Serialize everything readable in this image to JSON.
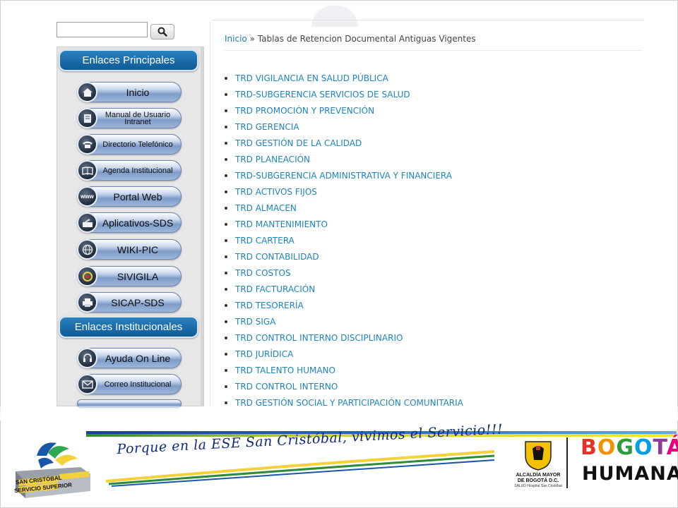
{
  "search": {
    "placeholder": "",
    "button_icon": "magnifier-icon"
  },
  "sidebar": {
    "section_main": "Enlaces Principales",
    "main_links": [
      {
        "label": "Inicio",
        "icon": "home-icon"
      },
      {
        "label": "Manual de Usuario Intranet",
        "icon": "manual-icon"
      },
      {
        "label": "Directorio Telefónico",
        "icon": "phone-icon"
      },
      {
        "label": "Agenda Institucional",
        "icon": "book-icon"
      },
      {
        "label": "Portal Web",
        "icon": "www-icon"
      },
      {
        "label": "Aplicativos-SDS",
        "icon": "apps-icon"
      },
      {
        "label": "WIKI-PIC",
        "icon": "globe-icon"
      },
      {
        "label": "SIVIGILA",
        "icon": "eye-icon"
      },
      {
        "label": "SICAP-SDS",
        "icon": "printer-icon"
      }
    ],
    "section_inst": "Enlaces Institucionales",
    "inst_links": [
      {
        "label": "Ayuda On Line",
        "icon": "headset-icon"
      },
      {
        "label": "Correo Institucional",
        "icon": "mail-icon"
      }
    ]
  },
  "breadcrumb": {
    "home": "Inicio",
    "separator": " » ",
    "current": "Tablas de Retencion Documental Antiguas Vigentes"
  },
  "trd_items": [
    "TRD VIGILANCIA EN SALUD PÚBLICA",
    "TRD-SUBGERENCIA SERVICIOS DE SALUD",
    "TRD PROMOCIÓN Y PREVENCIÓN",
    "TRD GERENCIA",
    "TRD GESTIÓN DE LA CALIDAD",
    "TRD PLANEACIÓN",
    "TRD-SUBGERENCIA ADMINISTRATIVA Y FINANCIERA",
    "TRD ACTIVOS FIJOS",
    "TRD ALMACEN",
    "TRD MANTENIMIENTO",
    "TRD CARTERA",
    "TRD CONTABILIDAD",
    "TRD COSTOS",
    "TRD FACTURACIÓN",
    "TRD TESORERÍA",
    "TRD SIGA",
    "TRD CONTROL INTERNO DISCIPLINARIO",
    "TRD JURÍDICA",
    "TRD TALENTO HUMANO",
    "TRD CONTROL INTERNO",
    "TRD GESTIÓN SOCIAL Y PARTICIPACIÓN  COMUNITARIA"
  ],
  "footer": {
    "slogan": "Porque en la ESE San Cristóbal, vivimos el Servicio!!!",
    "ese_logo_text_1": "SAN CRISTÓBAL",
    "ese_logo_text_2": "SERVICIO SUPERIOR",
    "alcaldia": "ALCALDÍA MAYOR DE BOGOTÁ D.C.",
    "alcaldia_sub": "SALUD Hospital San Cristóbal",
    "bogota": "BOGOTÁ",
    "humana": "HUMANA"
  },
  "colors": {
    "link": "#1d84bd",
    "header_blue": "#1467a6",
    "bogota_letters": [
      "#e4322b",
      "#f39200",
      "#2e9a3f",
      "#009fe3",
      "#8c3e96",
      "#e5007e"
    ]
  }
}
